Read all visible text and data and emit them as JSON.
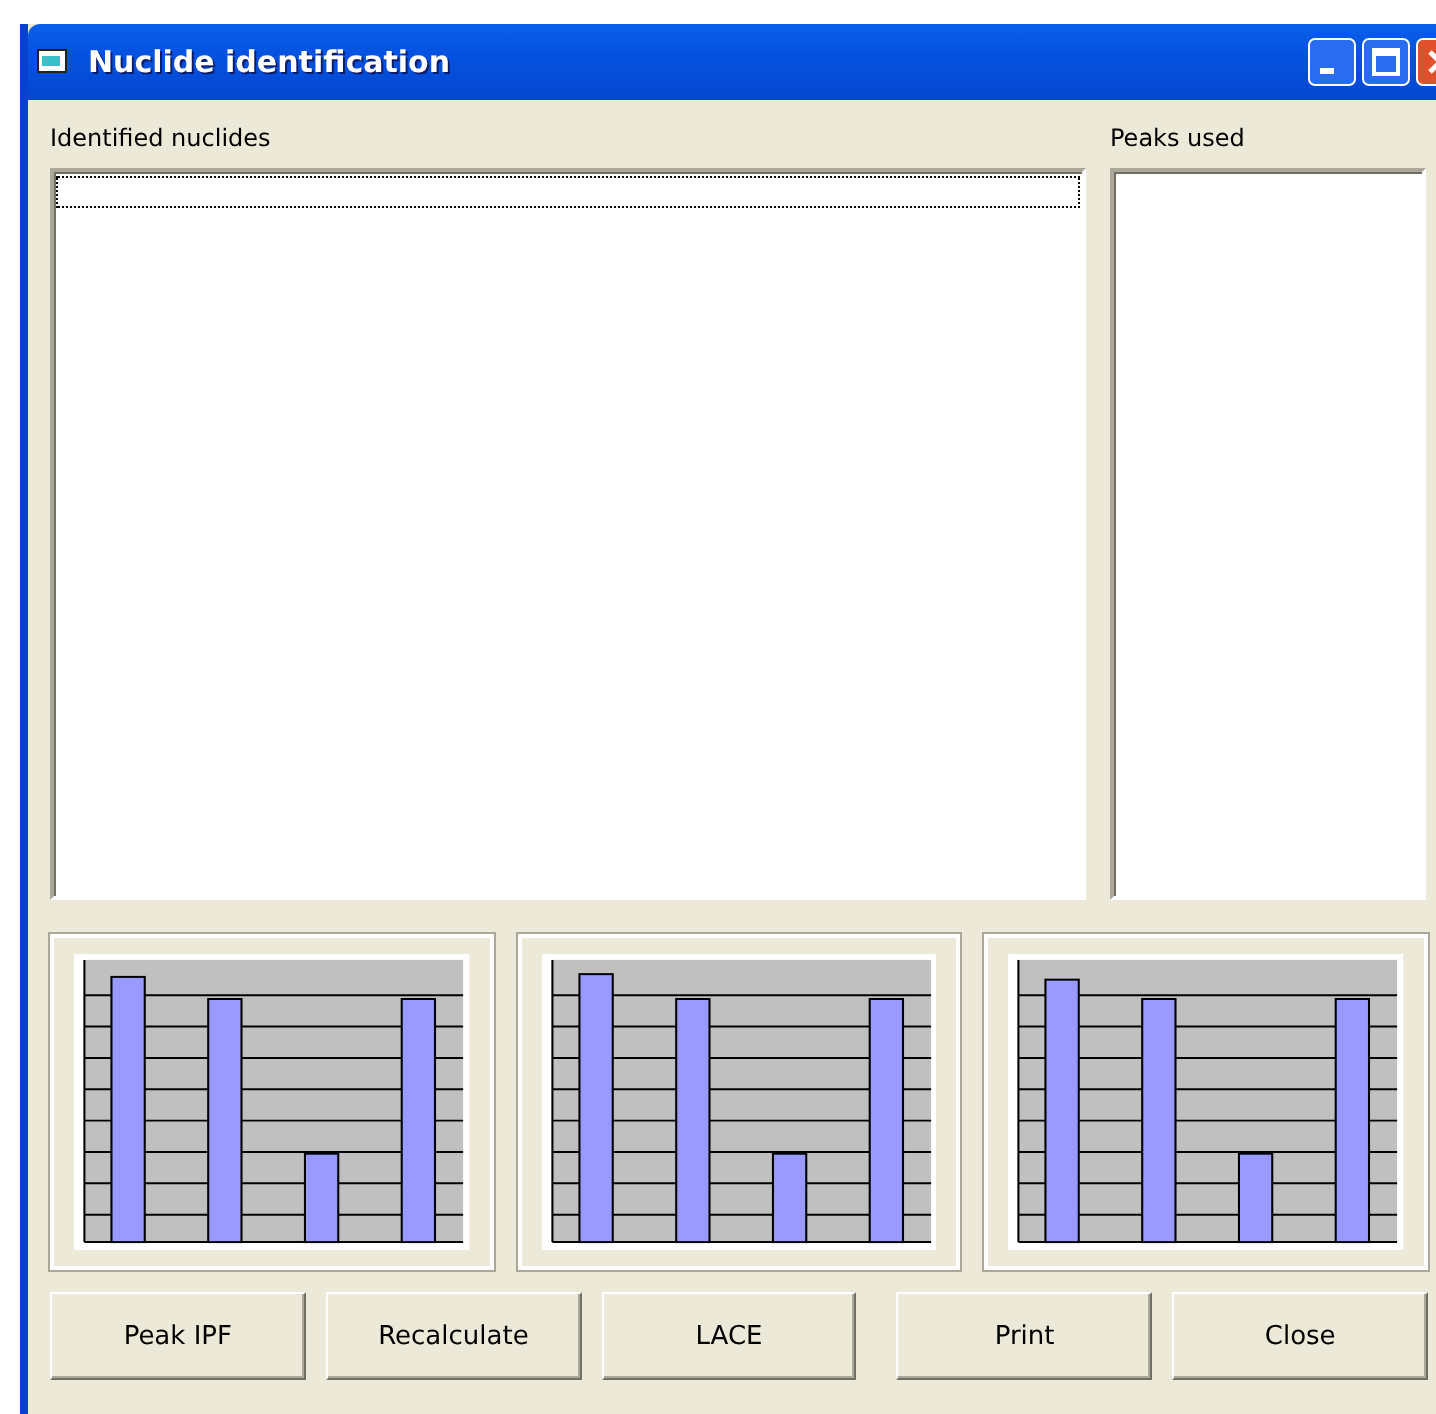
{
  "window": {
    "title": "Nuclide identification"
  },
  "identified_nuclides": {
    "label": "Identified nuclides"
  },
  "peaks_used": {
    "label": "Peaks used"
  },
  "buttons": [
    "Peak IPF",
    "Recalculate",
    "LACE",
    "Print",
    "Close"
  ]
}
